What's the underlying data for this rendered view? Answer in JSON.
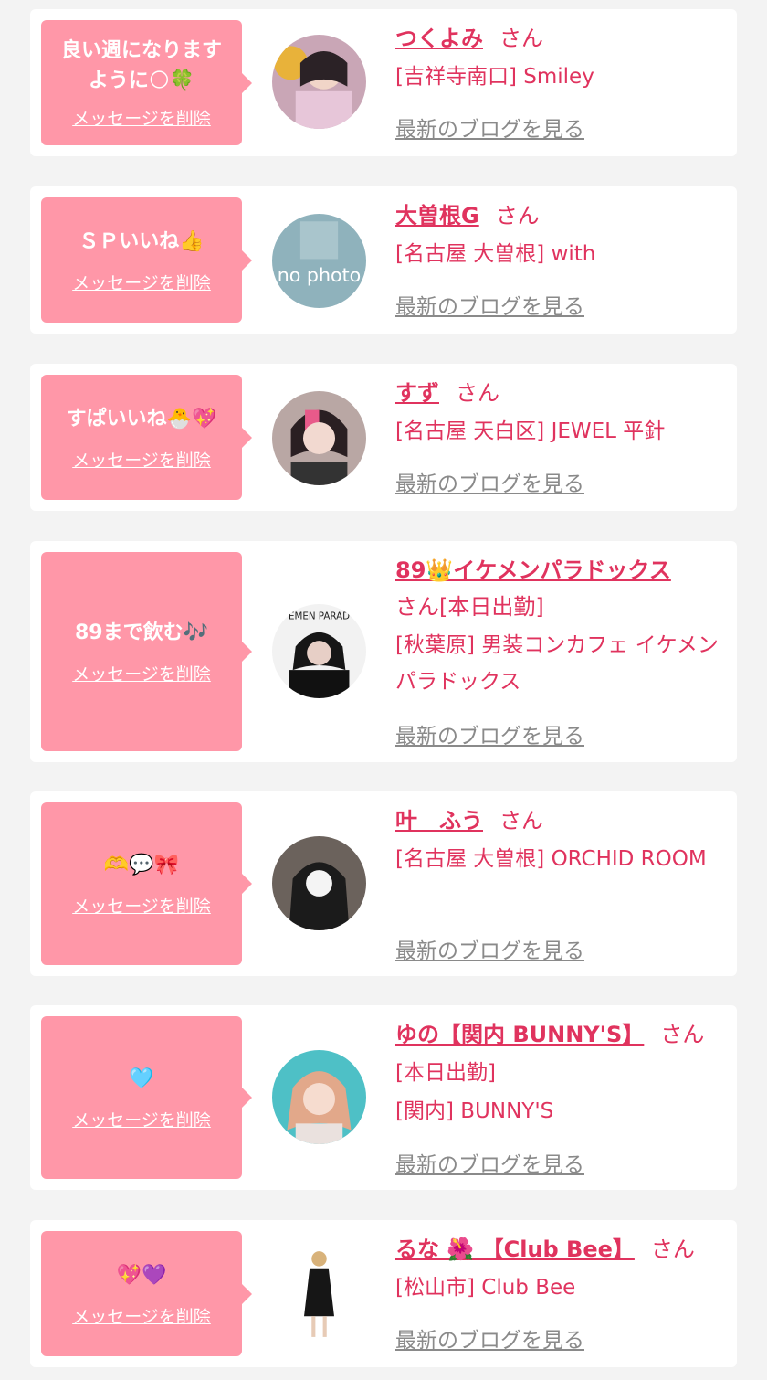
{
  "colors": {
    "bubble": "#ff97a8",
    "accent": "#e0335e",
    "muted": "#8a8a8a",
    "background": "#f3f3f3"
  },
  "delete_label": "メッセージを削除",
  "blog_label": "最新のブログを見る",
  "san_label": "さん",
  "items": [
    {
      "message": "良い週になります\nように🌕🍀",
      "name": "つくよみ",
      "status": "",
      "shop": "[吉祥寺南口] Smiley",
      "avatar": "profile-photo"
    },
    {
      "message": "ＳＰいいね👍",
      "name": "大曽根G",
      "status": "",
      "shop": "[名古屋 大曽根] with",
      "avatar": "no-photo"
    },
    {
      "message": "すぱいいね🐣💖",
      "name": "すず",
      "status": "",
      "shop": "[名古屋 天白区] JEWEL 平針",
      "avatar": "profile-photo"
    },
    {
      "message": "89まで飲む🎶",
      "name": "89👑イケメンパラドックス",
      "status": "[本日出勤]",
      "shop": "[秋葉原] 男装コンカフェ イケメンパラドックス",
      "avatar": "profile-photo"
    },
    {
      "message": "🫶💬🎀",
      "name": "叶　ふう",
      "status": "",
      "shop": "[名古屋 大曽根] ORCHID ROOM",
      "avatar": "profile-photo"
    },
    {
      "message": "🩵",
      "name": "ゆの【関内 BUNNY'S】",
      "status": "[本日出勤]",
      "shop": "[関内] BUNNY'S",
      "avatar": "profile-photo"
    },
    {
      "message": "💖💜",
      "name": "るな 🌺 【Club Bee】",
      "status": "",
      "shop": "[松山市] Club Bee",
      "avatar": "profile-photo"
    }
  ]
}
